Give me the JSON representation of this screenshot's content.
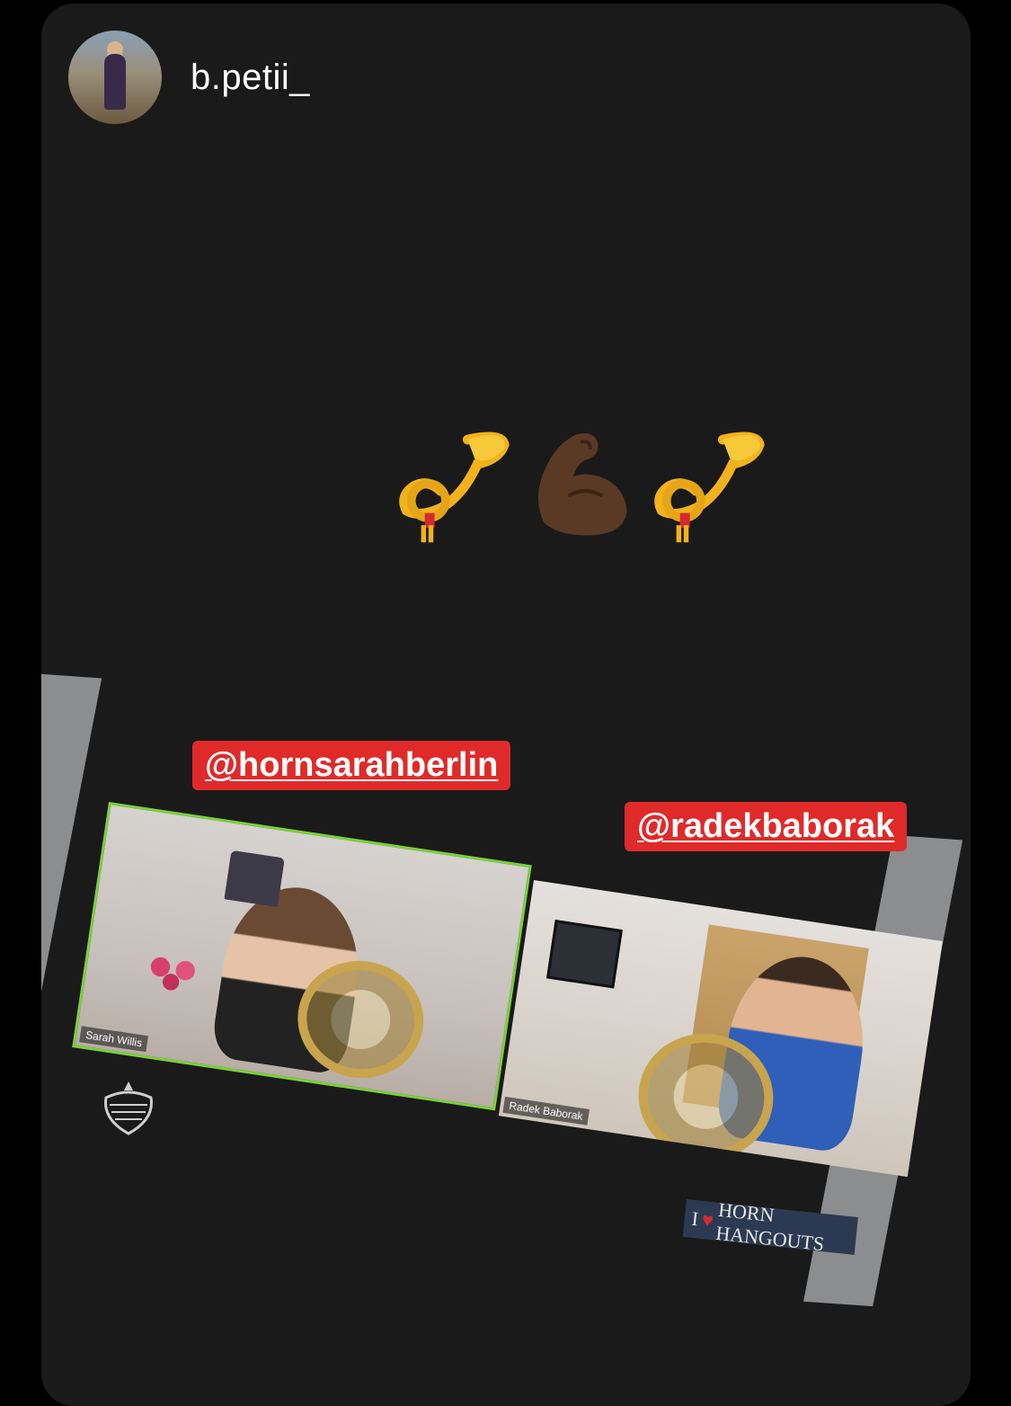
{
  "story": {
    "username": "b.petii_",
    "emojis": [
      {
        "name": "postal-horn-icon",
        "glyph": "📯"
      },
      {
        "name": "flexed-biceps-icon",
        "glyph": "💪"
      },
      {
        "name": "postal-horn-icon",
        "glyph": "📯"
      }
    ]
  },
  "screenshot": {
    "mentions": {
      "left": "@hornsarahberlin",
      "right": "@radekbaborak"
    },
    "tiles": {
      "left_label": "Sarah Willis",
      "right_label": "Radek Baborak"
    },
    "banner": {
      "prefix": "I",
      "text": "HORN HANGOUTS"
    }
  },
  "colors": {
    "background": "#000000",
    "card": "#1a1a1a",
    "mention_bg": "#e02a2a",
    "active_speaker_border": "#7bd13b",
    "side_bars": "#8b8d8f"
  }
}
